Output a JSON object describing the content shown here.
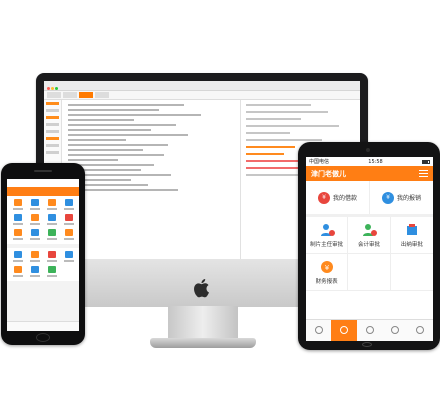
{
  "colors": {
    "accent": "#ff7e14",
    "blue": "#2f8fe0",
    "red": "#e8463d",
    "green": "#3db35a"
  },
  "desktop": {
    "window_title": "",
    "icons": [
      "apple-icon"
    ]
  },
  "phone": {
    "header_title": "",
    "section_title": "",
    "tabs": [
      "",
      "",
      "",
      ""
    ]
  },
  "tablet": {
    "status": {
      "carrier": "中国电信",
      "time": "15:58"
    },
    "app_title": "津门老傲儿",
    "quick_actions": [
      {
        "label": "我的借款",
        "icon": "loan-icon"
      },
      {
        "label": "我的报销",
        "icon": "reimburse-icon"
      }
    ],
    "approval_items": [
      {
        "label": "制片主任审批",
        "icon": "director-approval-icon"
      },
      {
        "label": "会计审批",
        "icon": "accountant-approval-icon"
      },
      {
        "label": "出纳审批",
        "icon": "cashier-approval-icon"
      },
      {
        "label": "财务报表",
        "icon": "finance-report-icon"
      }
    ],
    "tabbar": [
      "",
      "",
      "",
      "",
      ""
    ]
  }
}
